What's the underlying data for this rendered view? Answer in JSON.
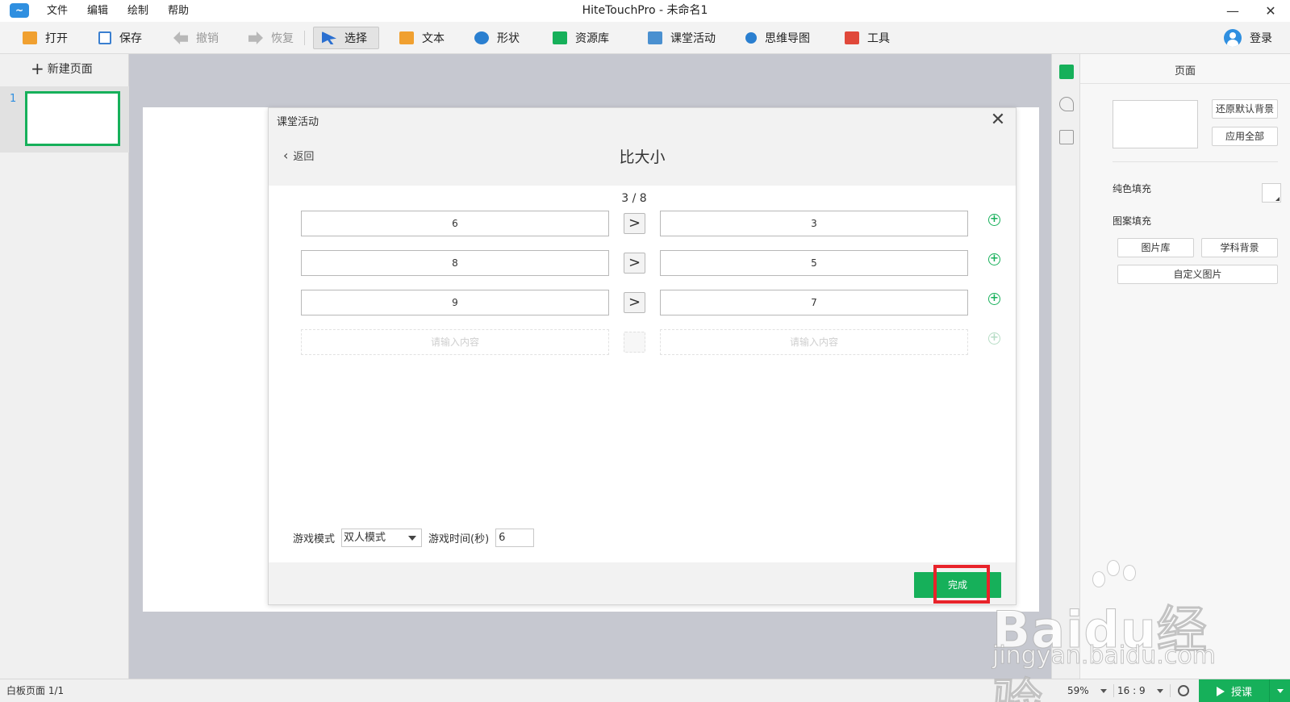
{
  "titlebar": {
    "window_title": "HiteTouchPro - 未命名1",
    "menu": [
      "文件",
      "编辑",
      "绘制",
      "帮助"
    ],
    "minimize_glyph": "—",
    "close_glyph": "✕"
  },
  "toolbar": {
    "open": "打开",
    "save": "保存",
    "undo": "撤销",
    "redo": "恢复",
    "select": "选择",
    "text": "文本",
    "shape": "形状",
    "resources": "资源库",
    "classroom": "课堂活动",
    "mindmap": "思维导图",
    "tools": "工具",
    "login": "登录"
  },
  "left_panel": {
    "new_page": "新建页面",
    "page_number": "1"
  },
  "modal": {
    "title": "课堂活动",
    "back": "返回",
    "activity_title": "比大小",
    "counter": "3 / 8",
    "rows": [
      {
        "left": "6",
        "op": ">",
        "right": "3"
      },
      {
        "left": "8",
        "op": ">",
        "right": "5"
      },
      {
        "left": "9",
        "op": ">",
        "right": "7"
      }
    ],
    "placeholder": "请输入内容",
    "game_mode_label": "游戏模式",
    "game_mode_value": "双人模式",
    "game_time_label": "游戏时间(秒)",
    "game_time_value": "6",
    "done": "完成"
  },
  "right_panel": {
    "title": "页面",
    "restore_bg": "还原默认背景",
    "apply_all": "应用全部",
    "solid_fill": "纯色填充",
    "pattern_fill": "图案填充",
    "gallery": "图片库",
    "subject_bg": "学科背景",
    "custom_image": "自定义图片"
  },
  "statusbar": {
    "page_info": "白板页面 1/1",
    "zoom": "59%",
    "ratio": "16 : 9",
    "teach": "授课"
  },
  "watermark": {
    "main": "Baidu经验",
    "sub": "jingyan.baidu.com"
  },
  "colors": {
    "accent_green": "#16b05a",
    "highlight_red": "#e8232a",
    "canvas_bg": "#c6c8d0",
    "brand_blue": "#2f8fe0"
  },
  "icons": {
    "open": "folder-icon",
    "save": "floppy-icon",
    "undo": "undo-arrow-icon",
    "redo": "redo-arrow-icon",
    "select": "cursor-icon",
    "text": "text-t-icon",
    "shape": "shape-icon",
    "resources": "library-icon",
    "classroom": "classroom-icon",
    "mindmap": "mindmap-icon",
    "tools": "toolbox-icon"
  }
}
